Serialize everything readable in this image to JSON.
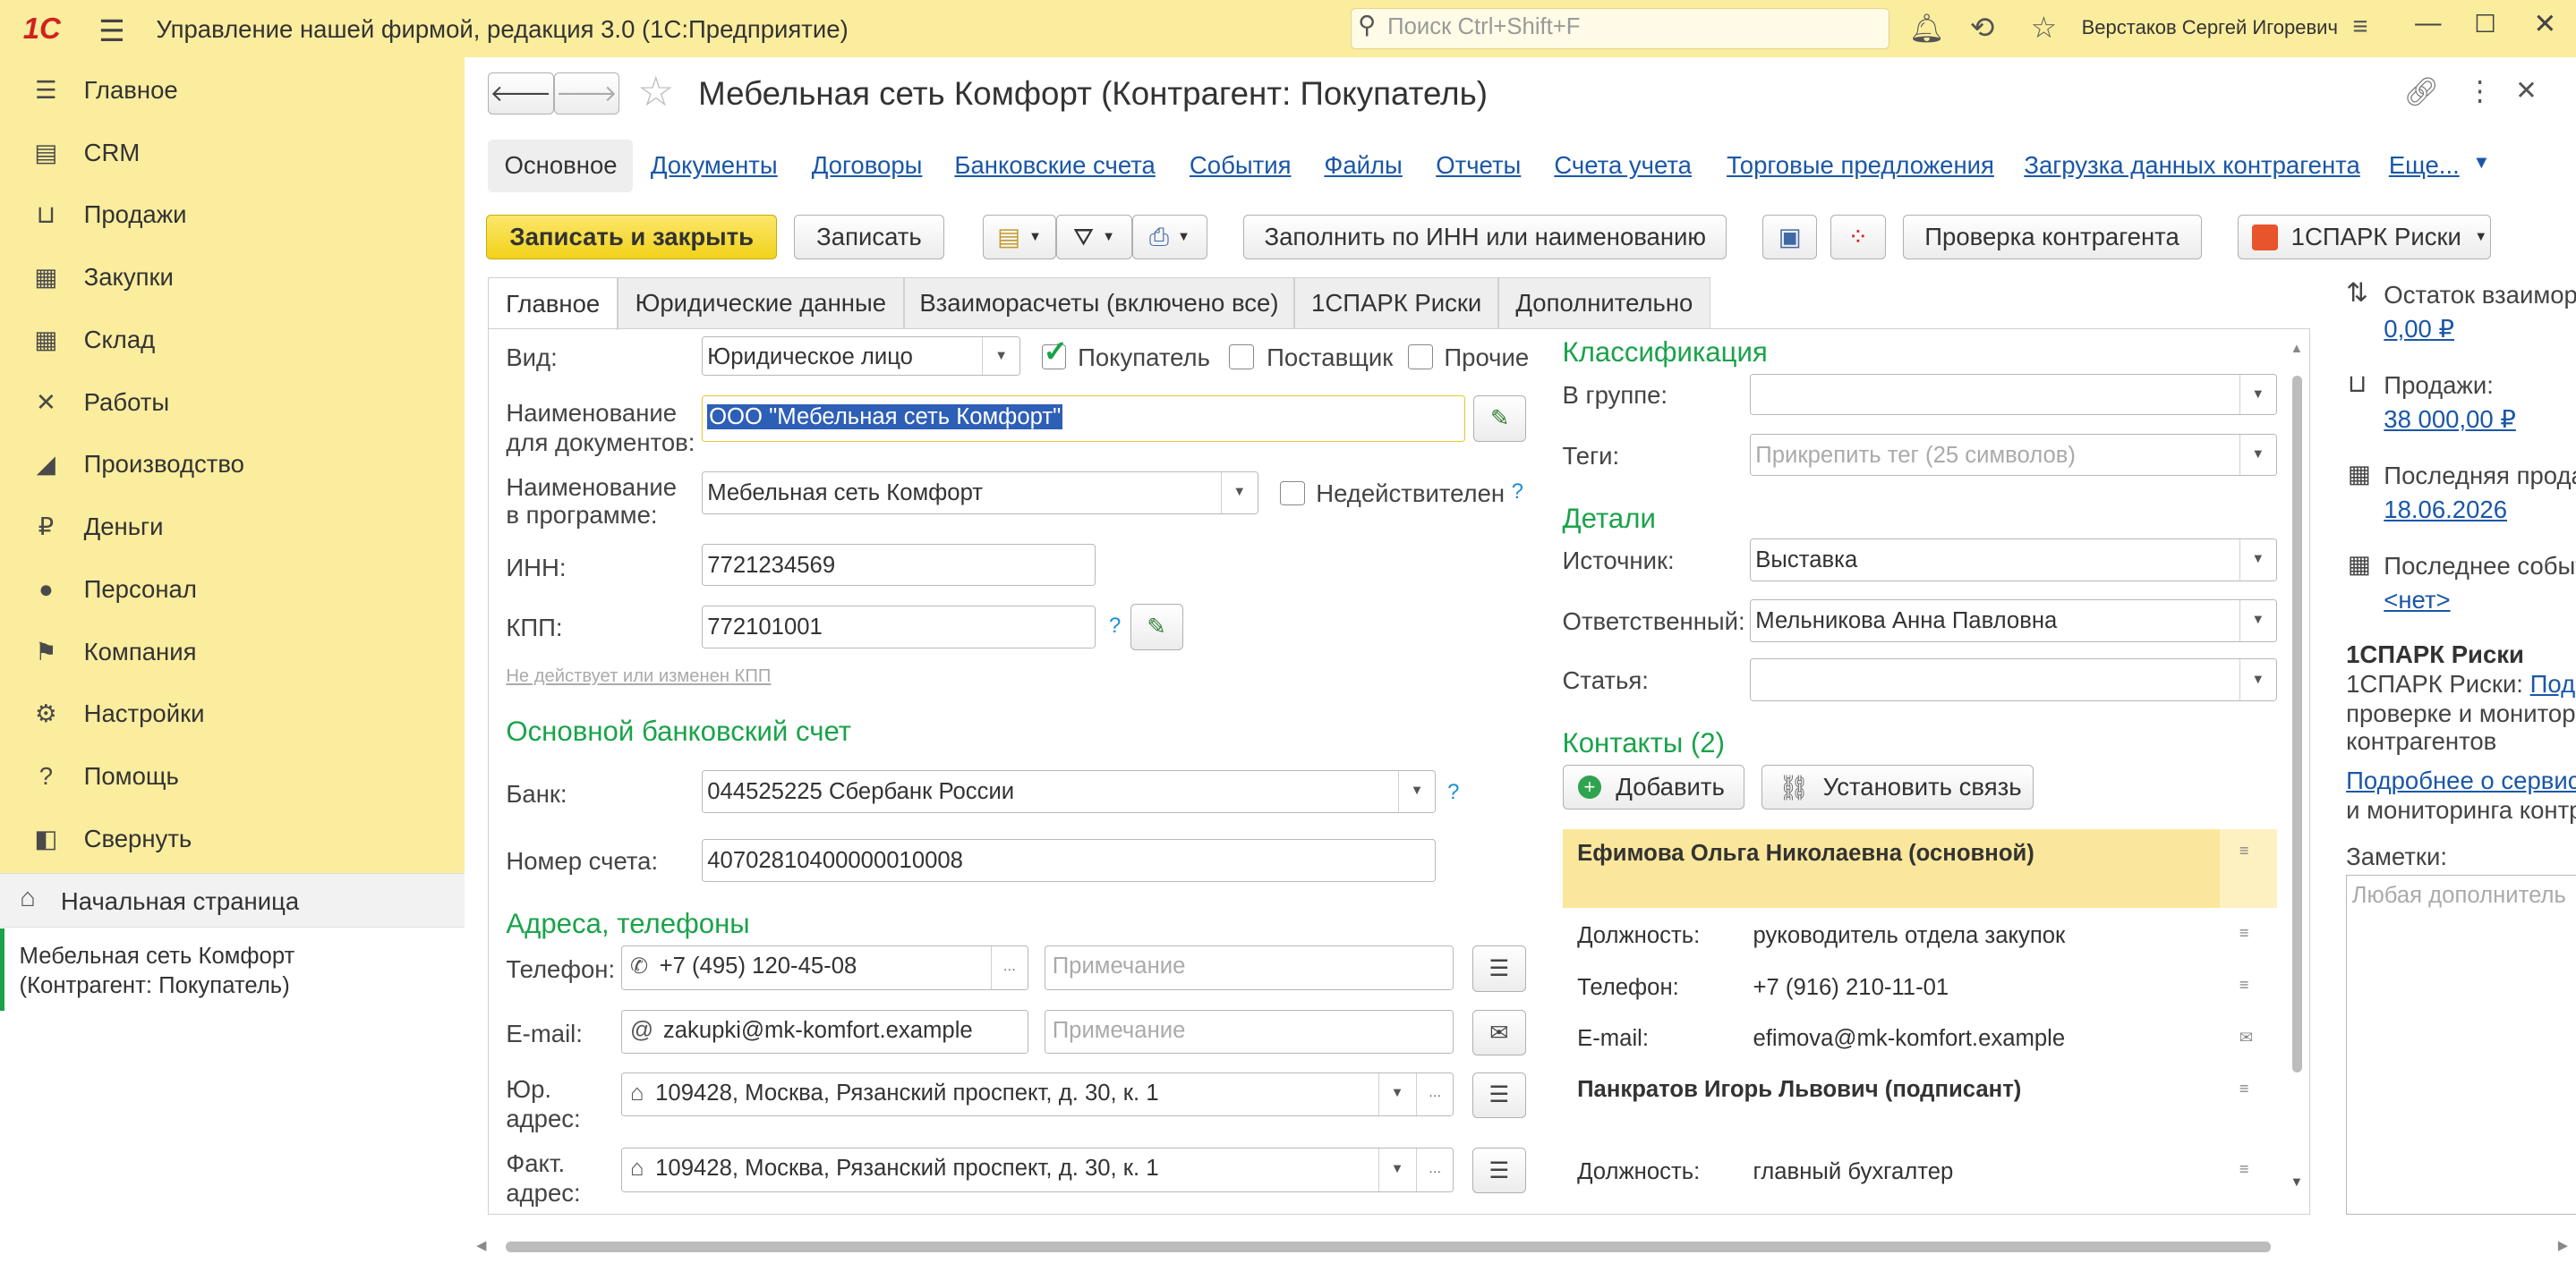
{
  "titlebar": {
    "app_title": "Управление нашей фирмой, редакция 3.0  (1С:Предприятие)",
    "search_placeholder": "Поиск Ctrl+Shift+F",
    "user": "Верстаков Сергей Игоревич"
  },
  "sidebar": {
    "items": [
      {
        "label": "Главное",
        "icon": "menu-lines-icon"
      },
      {
        "label": "CRM",
        "icon": "crm-icon"
      },
      {
        "label": "Продажи",
        "icon": "basket-icon"
      },
      {
        "label": "Закупки",
        "icon": "cart-icon"
      },
      {
        "label": "Склад",
        "icon": "warehouse-icon"
      },
      {
        "label": "Работы",
        "icon": "tools-icon"
      },
      {
        "label": "Производство",
        "icon": "factory-icon"
      },
      {
        "label": "Деньги",
        "icon": "ruble-icon"
      },
      {
        "label": "Персонал",
        "icon": "person-icon"
      },
      {
        "label": "Компания",
        "icon": "flag-icon"
      },
      {
        "label": "Настройки",
        "icon": "gear-icon"
      },
      {
        "label": "Помощь",
        "icon": "help-icon"
      },
      {
        "label": "Свернуть",
        "icon": "collapse-icon"
      }
    ],
    "home": "Начальная страница",
    "open_tab_line1": "Мебельная сеть Комфорт",
    "open_tab_line2": "(Контрагент: Покупатель)"
  },
  "form": {
    "title": "Мебельная сеть Комфорт (Контрагент: Покупатель)",
    "nav_links": [
      "Основное",
      "Документы",
      "Договоры",
      "Банковские счета",
      "События",
      "Файлы",
      "Отчеты",
      "Счета учета",
      "Торговые предложения",
      "Загрузка данных контрагента",
      "Еще..."
    ],
    "toolbar": {
      "save_close": "Записать и закрыть",
      "save": "Записать",
      "fill_inn": "Заполнить по ИНН или наименованию",
      "check": "Проверка контрагента",
      "spark": "1СПАРК Риски"
    },
    "tabs": [
      "Главное",
      "Юридические данные",
      "Взаиморасчеты (включено все)",
      "1СПАРК Риски",
      "Дополнительно"
    ],
    "main": {
      "vid_label": "Вид:",
      "vid_value": "Юридическое лицо",
      "cb_buyer": "Покупатель",
      "cb_supplier": "Поставщик",
      "cb_other": "Прочие",
      "name_doc_label1": "Наименование",
      "name_doc_label2": "для документов:",
      "name_doc_value": "ООО \"Мебельная сеть Комфорт\"",
      "name_prog_label1": "Наименование",
      "name_prog_label2": "в программе:",
      "name_prog_value": "Мебельная сеть Комфорт",
      "invalid_label": "Недействителен",
      "inn_label": "ИНН:",
      "inn_value": "7721234569",
      "kpp_label": "КПП:",
      "kpp_value": "772101001",
      "kpp_hint": "Не действует или изменен КПП",
      "bank_header": "Основной банковский счет",
      "bank_label": "Банк:",
      "bank_value": "044525225 Сбербанк России",
      "account_label": "Номер счета:",
      "account_value": "40702810400000010008",
      "addr_header": "Адреса, телефоны",
      "phone_label": "Телефон:",
      "phone_value": "+7 (495) 120-45-08",
      "note_placeholder": "Примечание",
      "email_label": "E-mail:",
      "email_value": "zakupki@mk-komfort.example",
      "ur_label1": "Юр.",
      "ur_label2": "адрес:",
      "ur_value": "109428, Москва, Рязанский проспект, д. 30, к. 1",
      "fact_label1": "Факт.",
      "fact_label2": "адрес:",
      "fact_value": "109428, Москва, Рязанский проспект, д. 30, к. 1"
    },
    "right": {
      "class_header": "Классификация",
      "group_label": "В группе:",
      "tags_label": "Теги:",
      "tags_placeholder": "Прикрепить тег (25 символов)",
      "details_header": "Детали",
      "source_label": "Источник:",
      "source_value": "Выставка",
      "resp_label": "Ответственный:",
      "resp_value": "Мельникова Анна Павловна",
      "article_label": "Статья:",
      "contacts_header": "Контакты (2)",
      "add_btn": "Добавить",
      "link_btn": "Установить связь",
      "contact1_name": "Ефимова Ольга Николаевна (основной)",
      "c1_pos_label": "Должность:",
      "c1_pos": "руководитель отдела закупок",
      "c1_phone_label": "Телефон:",
      "c1_phone": "+7 (916) 210-11-01",
      "c1_email_label": "E-mail:",
      "c1_email": "efimova@mk-komfort.example",
      "contact2_name": "Панкратов Игорь Львович (подписант)",
      "c2_pos_label": "Должность:",
      "c2_pos": "главный бухгалтер"
    },
    "info": {
      "balance_label": "Остаток взаимор",
      "balance_value": "0,00 ₽",
      "sales_label": "Продажи:",
      "sales_value": "38 000,00 ₽",
      "last_sale_label": "Последняя прода",
      "last_sale_value": "18.06.2026",
      "last_event_label": "Последнее событ",
      "last_event_value": "<нет>",
      "spark_title": "1СПАРК Риски",
      "spark_text1": "1СПАРК Риски: ",
      "spark_link1": "Подр",
      "spark_text2": "проверке и монитор",
      "spark_text3": "контрагентов",
      "spark_link2": "Подробнее о сервис",
      "spark_text4": "и мониторинга контр",
      "notes_label": "Заметки:",
      "notes_placeholder": "Любая дополнитель"
    }
  }
}
